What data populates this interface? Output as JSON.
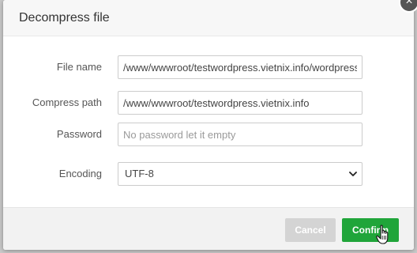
{
  "dialog": {
    "title": "Decompress file",
    "close_icon": "close-icon",
    "close_glyph": "×"
  },
  "form": {
    "file_name": {
      "label": "File name",
      "value": "/www/wwwroot/testwordpress.vietnix.info/wordpress"
    },
    "compress_path": {
      "label": "Compress path",
      "value": "/www/wwwroot/testwordpress.vietnix.info"
    },
    "password": {
      "label": "Password",
      "value": "",
      "placeholder": "No password let it empty"
    },
    "encoding": {
      "label": "Encoding",
      "selected": "UTF-8",
      "arrow_icon": "chevron-down-icon"
    }
  },
  "footer": {
    "cancel_label": "Cancel",
    "confirm_label": "Confirm",
    "cursor_icon": "hand-pointer-icon"
  },
  "colors": {
    "confirm_bg": "#20a53a",
    "cancel_bg": "#d4d4d4",
    "header_bg": "#f7f7f7",
    "overlay_bg": "#c9c9c9"
  }
}
